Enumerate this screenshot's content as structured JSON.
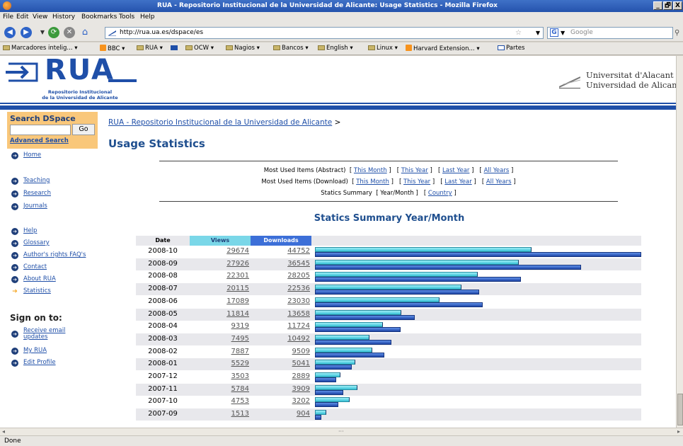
{
  "window": {
    "title": "RUA - Repositorio Institucional de la Universidad de Alicante: Usage Statistics - Mozilla Firefox",
    "buttons": [
      "_",
      "🗗",
      "X"
    ]
  },
  "menu": [
    "File",
    "Edit",
    "View",
    "History",
    "Bookmarks",
    "Tools",
    "Help"
  ],
  "toolbar": {
    "url": "http://rua.ua.es/dspace/es",
    "search_placeholder": "Google"
  },
  "bookmarks": [
    {
      "label": "Marcadores intelig...",
      "icon": "folder-icon"
    },
    {
      "label": "BBC",
      "icon": "rss-icon"
    },
    {
      "label": "RUA",
      "icon": "folder-icon"
    },
    {
      "label": "",
      "icon": "ua-logo-icon"
    },
    {
      "label": "OCW",
      "icon": "folder-icon"
    },
    {
      "label": "Nagios",
      "icon": "folder-icon"
    },
    {
      "label": "Bancos",
      "icon": "folder-icon"
    },
    {
      "label": "English",
      "icon": "folder-icon"
    },
    {
      "label": "Linux",
      "icon": "folder-icon"
    },
    {
      "label": "Harvard Extension...",
      "icon": "rss-icon"
    },
    {
      "label": "Partes",
      "icon": "ua-logo-icon"
    }
  ],
  "header": {
    "logo_text": "RUA",
    "logo_sub1": "Repositorio Institucional",
    "logo_sub2": "de la Universidad de Alicante",
    "uni_line1": "Universitat d'Alacant",
    "uni_line2": "Universidad de Alicante"
  },
  "sidebar": {
    "search_title": "Search DSpace",
    "go_label": "Go",
    "advanced_search": "Advanced Search",
    "links1": [
      "Home"
    ],
    "links2": [
      "Teaching",
      "Research",
      "Journals"
    ],
    "links3": [
      "Help",
      "Glossary",
      "Author's rights FAQ's",
      "Contact",
      "About RUA",
      "Statistics"
    ],
    "signon_title": "Sign on to:",
    "signon_links": [
      "Receive email updates",
      "My RUA",
      "Edit Profile"
    ]
  },
  "main": {
    "breadcrumb_link": "RUA - Repositorio Institucional de la Universidad de Alicante",
    "breadcrumb_sep": ">",
    "title": "Usage Statistics",
    "rows": [
      {
        "label": "Most Used Items (Abstract)",
        "links": [
          "This Month",
          "This Year",
          "Last Year",
          "All Years"
        ]
      },
      {
        "label": "Most Used Items (Download)",
        "links": [
          "This Month",
          "This Year",
          "Last Year",
          "All Years"
        ]
      },
      {
        "label": "Statics Summary",
        "current": "Year/Month",
        "links": [
          "Country"
        ]
      }
    ],
    "summary_title": "Statics Summary Year/Month"
  },
  "table": {
    "headers": [
      "Date",
      "Views",
      "Downloads"
    ],
    "rows": [
      {
        "date": "2008-10",
        "views": 29674,
        "downloads": 44752
      },
      {
        "date": "2008-09",
        "views": 27926,
        "downloads": 36545
      },
      {
        "date": "2008-08",
        "views": 22301,
        "downloads": 28205
      },
      {
        "date": "2008-07",
        "views": 20115,
        "downloads": 22536
      },
      {
        "date": "2008-06",
        "views": 17089,
        "downloads": 23030
      },
      {
        "date": "2008-05",
        "views": 11814,
        "downloads": 13658
      },
      {
        "date": "2008-04",
        "views": 9319,
        "downloads": 11724
      },
      {
        "date": "2008-03",
        "views": 7495,
        "downloads": 10492
      },
      {
        "date": "2008-02",
        "views": 7887,
        "downloads": 9509
      },
      {
        "date": "2008-01",
        "views": 5529,
        "downloads": 5041
      },
      {
        "date": "2007-12",
        "views": 3503,
        "downloads": 2889
      },
      {
        "date": "2007-11",
        "views": 5784,
        "downloads": 3909
      },
      {
        "date": "2007-10",
        "views": 4753,
        "downloads": 3202
      },
      {
        "date": "2007-09",
        "views": 1513,
        "downloads": 904
      }
    ]
  },
  "status": "Done",
  "colors": {
    "brand": "#1f4fa8",
    "views_bar": "#34bfd4",
    "downloads_bar": "#1e45a6",
    "sidebar_search_bg": "#f9c77a"
  }
}
